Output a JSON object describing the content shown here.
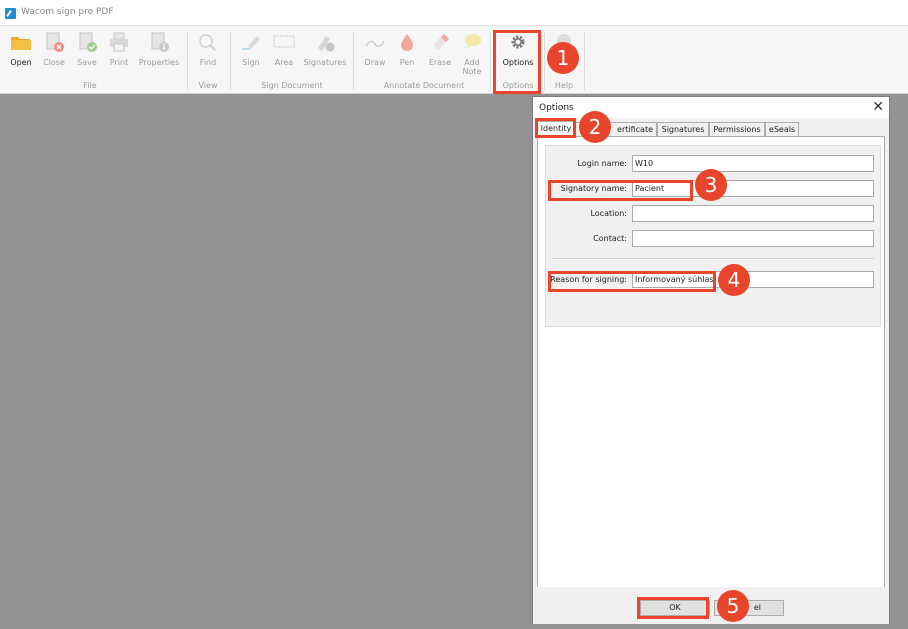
{
  "app": {
    "title": "Wacom sign pro PDF"
  },
  "ribbon": {
    "groups": {
      "file": "File",
      "view": "View",
      "sign": "Sign Document",
      "annotate": "Annotate Document",
      "options": "Options",
      "help": "Help"
    },
    "tools": {
      "open": "Open",
      "close": "Close",
      "save": "Save",
      "print": "Print",
      "properties": "Properties",
      "find": "Find",
      "sign": "Sign",
      "area": "Area",
      "signatures": "Signatures",
      "draw": "Draw",
      "pen": "Pen",
      "erase": "Erase",
      "add_note_1": "Add",
      "add_note_2": "Note",
      "options": "Options"
    }
  },
  "dialog": {
    "title": "Options",
    "tabs": [
      "Identity",
      "Certificate",
      "Signatures",
      "Permissions",
      "eSeals"
    ],
    "visible_tab_text": {
      "certificate": "ertificate"
    },
    "fields": {
      "login_name": {
        "label": "Login name:",
        "value": "W10"
      },
      "signatory_name": {
        "label": "Signatory name:",
        "value": "Pacient"
      },
      "location": {
        "label": "Location:",
        "value": ""
      },
      "contact": {
        "label": "Contact:",
        "value": ""
      },
      "reason": {
        "label": "Reason for signing:",
        "value": "Informovaný súhlas"
      }
    },
    "buttons": {
      "ok": "OK",
      "cancel_visible": "el"
    }
  },
  "markers": [
    "1",
    "2",
    "3",
    "4",
    "5"
  ],
  "colors": {
    "callout": "#e8452c",
    "workspace": "#939393",
    "accent_blue": "#1c8fd6"
  }
}
